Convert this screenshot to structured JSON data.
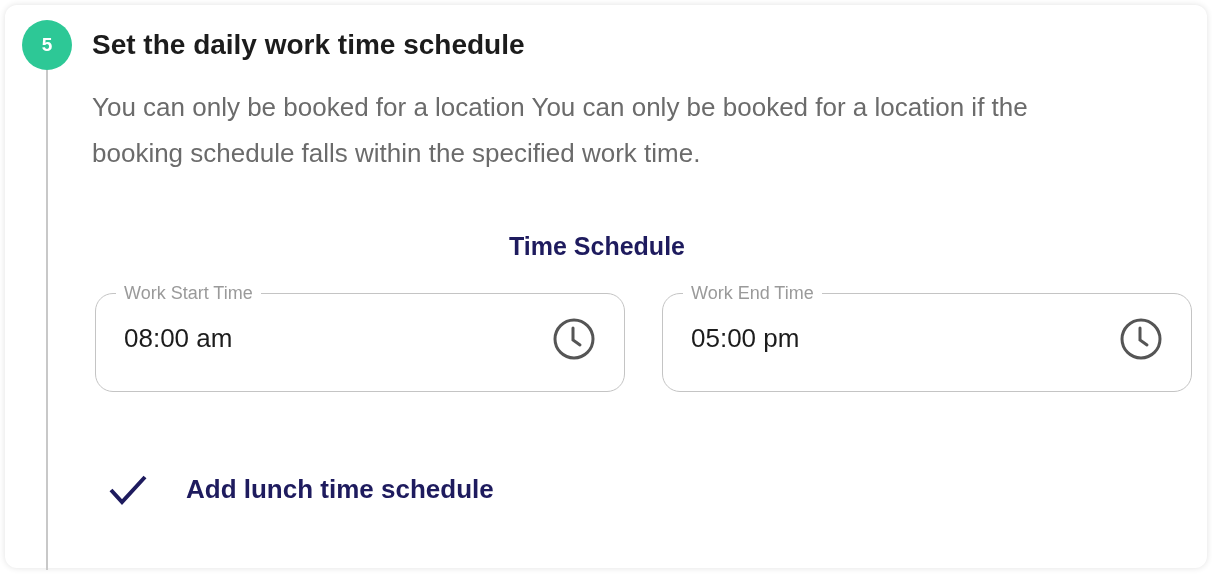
{
  "step": {
    "number": "5",
    "title": "Set the daily work time schedule",
    "description": "You can only be booked for a location You can only be booked for a location if the booking schedule falls within the specified work time."
  },
  "section_title": "Time Schedule",
  "fields": [
    {
      "label": "Work Start Time",
      "value": "08:00 am"
    },
    {
      "label": "Work End Time",
      "value": "05:00 pm"
    }
  ],
  "lunch": {
    "label": "Add lunch time schedule",
    "checked": true
  }
}
